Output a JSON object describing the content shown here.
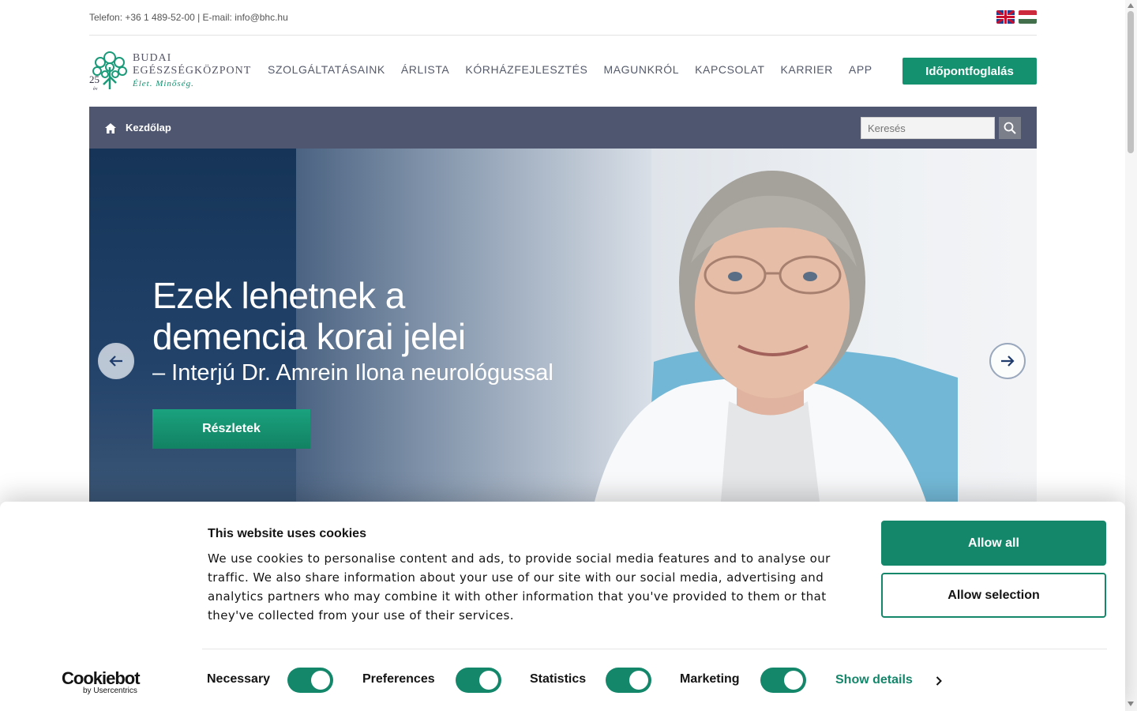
{
  "topbar": {
    "contact": "Telefon: +36 1 489-52-00 | E-mail: info@bhc.hu",
    "languages": [
      "en",
      "hu"
    ]
  },
  "header": {
    "logo": {
      "badge": "25",
      "badge_sub": "év",
      "name_line1": "BUDAI",
      "name_line2": "EGÉSZSÉGKÖZPONT",
      "motto": "Élet. Minőség."
    },
    "nav": [
      "SZOLGÁLTATÁSAINK",
      "ÁRLISTA",
      "KÓRHÁZFEJLESZTÉS",
      "MAGUNKRÓL",
      "KAPCSOLAT",
      "KARRIER",
      "APP"
    ],
    "book_button": "Időpontfoglalás"
  },
  "breadcrumb": {
    "home": "Kezdőlap",
    "search_placeholder": "Keresés"
  },
  "hero": {
    "title_line1": "Ezek lehetnek a",
    "title_line2": "demencia korai jelei",
    "subtitle": "– Interjú Dr. Amrein Ilona neurológussal",
    "button": "Részletek"
  },
  "cookie": {
    "title": "This website uses cookies",
    "text": "We use cookies to personalise content and ads, to provide social media features and to analyse our traffic. We also share information about your use of our site with our social media, advertising and analytics partners who may combine it with other information that you've provided to them or that they've collected from your use of their services.",
    "allow_all": "Allow all",
    "allow_selection": "Allow selection",
    "brand": "Cookiebot",
    "brand_sub": "by Usercentrics",
    "toggles": [
      {
        "label": "Necessary",
        "on": true
      },
      {
        "label": "Preferences",
        "on": true
      },
      {
        "label": "Statistics",
        "on": true
      },
      {
        "label": "Marketing",
        "on": true
      }
    ],
    "show_details": "Show details"
  },
  "colors": {
    "brand_green": "#14916f",
    "cookie_green": "#14876b",
    "crumb_bar": "#4f5670"
  }
}
